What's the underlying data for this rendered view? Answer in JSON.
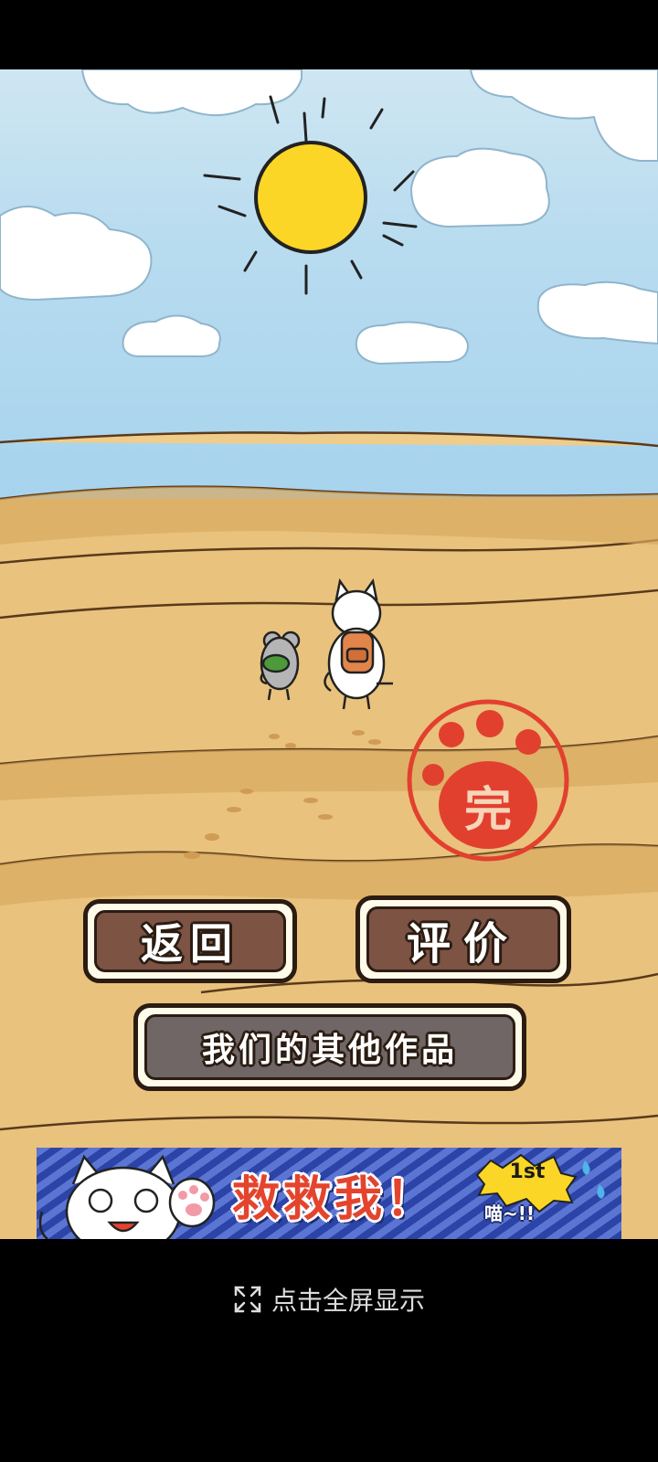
{
  "menu": {
    "back_label": "返回",
    "rate_label": "评价",
    "other_works_label": "我们的其他作品"
  },
  "stamp": {
    "label": "完",
    "color": "#e2402f"
  },
  "ad": {
    "title": "救救我！",
    "badge": "1st",
    "subtitle": "喵~!!"
  },
  "fullscreen_hint": "点击全屏显示",
  "colors": {
    "button_fill": "#7d5344",
    "button_border": "#2b1c12",
    "sand": "#e9c27d",
    "sky": "#a7d3ee",
    "sun": "#fbd626"
  }
}
